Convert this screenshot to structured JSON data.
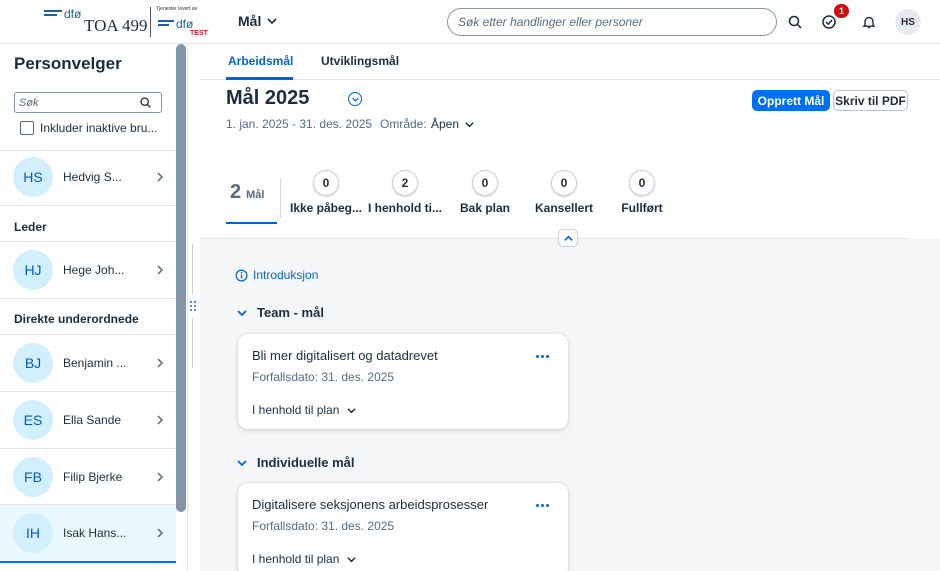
{
  "header": {
    "logo_main": "dfø",
    "logo_brand": "TOA 499",
    "logo2_caption": "Tjenester levert av",
    "logo2_text": "dfø",
    "logo2_tag": "TEST",
    "app_menu_label": "Mål",
    "search_placeholder": "Søk etter handlinger eller personer",
    "notification_count": "1",
    "avatar_initials": "HS"
  },
  "sidebar": {
    "title": "Personvelger",
    "search_placeholder": "Søk",
    "include_inactive_label": "Inkluder inaktive bru...",
    "self": {
      "initials": "HS",
      "name": "Hedvig S..."
    },
    "leader_label": "Leder",
    "leader": {
      "initials": "HJ",
      "name": "Hege Joh..."
    },
    "reports_label": "Direkte underordnede",
    "reports": [
      {
        "initials": "BJ",
        "name": "Benjamin ..."
      },
      {
        "initials": "ES",
        "name": "Ella Sande"
      },
      {
        "initials": "FB",
        "name": "Filip Bjerke"
      },
      {
        "initials": "IH",
        "name": "Isak Hans..."
      }
    ]
  },
  "main": {
    "tabs": [
      {
        "label": "Arbeidsmål",
        "active": true
      },
      {
        "label": "Utviklingsmål",
        "active": false
      }
    ],
    "title": "Mål 2025",
    "date_range": "1. jan. 2025 - 31. des. 2025",
    "area_label": "Område:",
    "area_value": "Åpen",
    "create_button": "Opprett Mål",
    "pdf_button": "Skriv til PDF",
    "summary": {
      "count": "2",
      "label": "Mål"
    },
    "kpis": [
      {
        "value": "0",
        "label": "Ikke påbeg..."
      },
      {
        "value": "2",
        "label": "I henhold ti..."
      },
      {
        "value": "0",
        "label": "Bak plan"
      },
      {
        "value": "0",
        "label": "Kansellert"
      },
      {
        "value": "0",
        "label": "Fullført"
      }
    ],
    "intro_link": "Introduksjon",
    "sections": [
      {
        "title": "Team - mål",
        "goal": {
          "title": "Bli mer digitalisert og datadrevet",
          "due": "Forfallsdato: 31. des. 2025",
          "status": "I henhold til plan"
        }
      },
      {
        "title": "Individuelle mål",
        "goal": {
          "title": "Digitalisere seksjonens arbeidsprosesser",
          "due": "Forfallsdato: 31. des. 2025",
          "status": "I henhold til plan"
        }
      }
    ]
  },
  "colors": {
    "accent": "#0070f2",
    "link": "#0064d9",
    "avatar_bg": "#d1efff",
    "badge": "#d20a0a",
    "test_tag": "#e0152d"
  }
}
